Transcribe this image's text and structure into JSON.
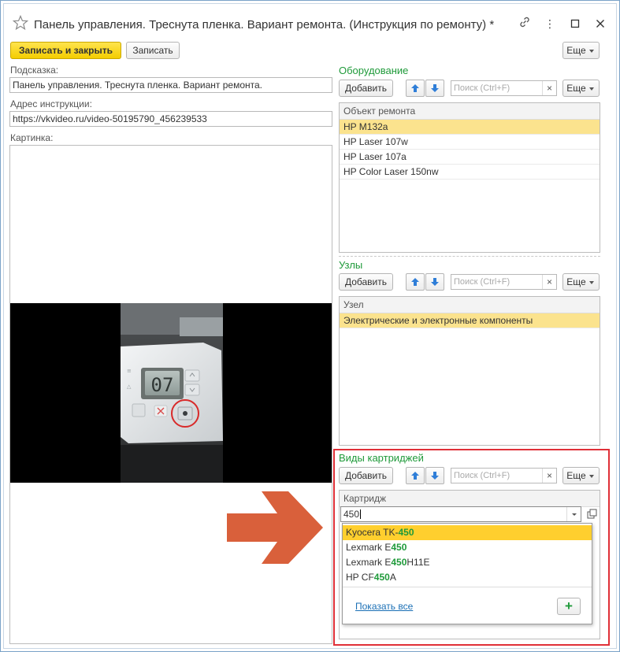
{
  "window": {
    "title": "Панель управления. Треснута пленка. Вариант ремонта. (Инструкция по ремонту) *"
  },
  "toolbar": {
    "save_close_label": "Записать и закрыть",
    "save_label": "Записать",
    "more_label": "Еще"
  },
  "form": {
    "hint_label": "Подсказка:",
    "hint_value": "Панель управления. Треснута пленка. Вариант ремонта.",
    "address_label": "Адрес инструкции:",
    "address_value": "https://vkvideo.ru/video-50195790_456239533",
    "picture_label": "Картинка:",
    "picture": {
      "display_digits": "07"
    }
  },
  "equipment": {
    "title": "Оборудование",
    "add_label": "Добавить",
    "search_placeholder": "Поиск (Ctrl+F)",
    "more_label": "Еще",
    "column": "Объект ремонта",
    "rows": [
      "HP M132a",
      "HP Laser 107w",
      "HP Laser 107a",
      "HP Color Laser 150nw"
    ]
  },
  "nodes": {
    "title": "Узлы",
    "add_label": "Добавить",
    "search_placeholder": "Поиск (Ctrl+F)",
    "more_label": "Еще",
    "column": "Узел",
    "rows": [
      "Электрические и электронные компоненты"
    ]
  },
  "cartridges": {
    "title": "Виды картриджей",
    "add_label": "Добавить",
    "search_placeholder": "Поиск (Ctrl+F)",
    "more_label": "Еще",
    "column": "Картридж",
    "input_value": "450",
    "dropdown": {
      "items": [
        {
          "pre": "Kyocera TK-",
          "match": "450",
          "post": ""
        },
        {
          "pre": "Lexmark E",
          "match": "450",
          "post": ""
        },
        {
          "pre": "Lexmark E",
          "match": "450",
          "post": "H11E"
        },
        {
          "pre": "HP CF",
          "match": "450",
          "post": "A"
        }
      ],
      "show_all_label": "Показать все",
      "plus_label": "+"
    }
  },
  "colors": {
    "accent_green": "#1f9a3a",
    "selection_yellow": "#fbe38e",
    "highlight_red": "#e03038",
    "arrow_orange": "#d9603b"
  }
}
